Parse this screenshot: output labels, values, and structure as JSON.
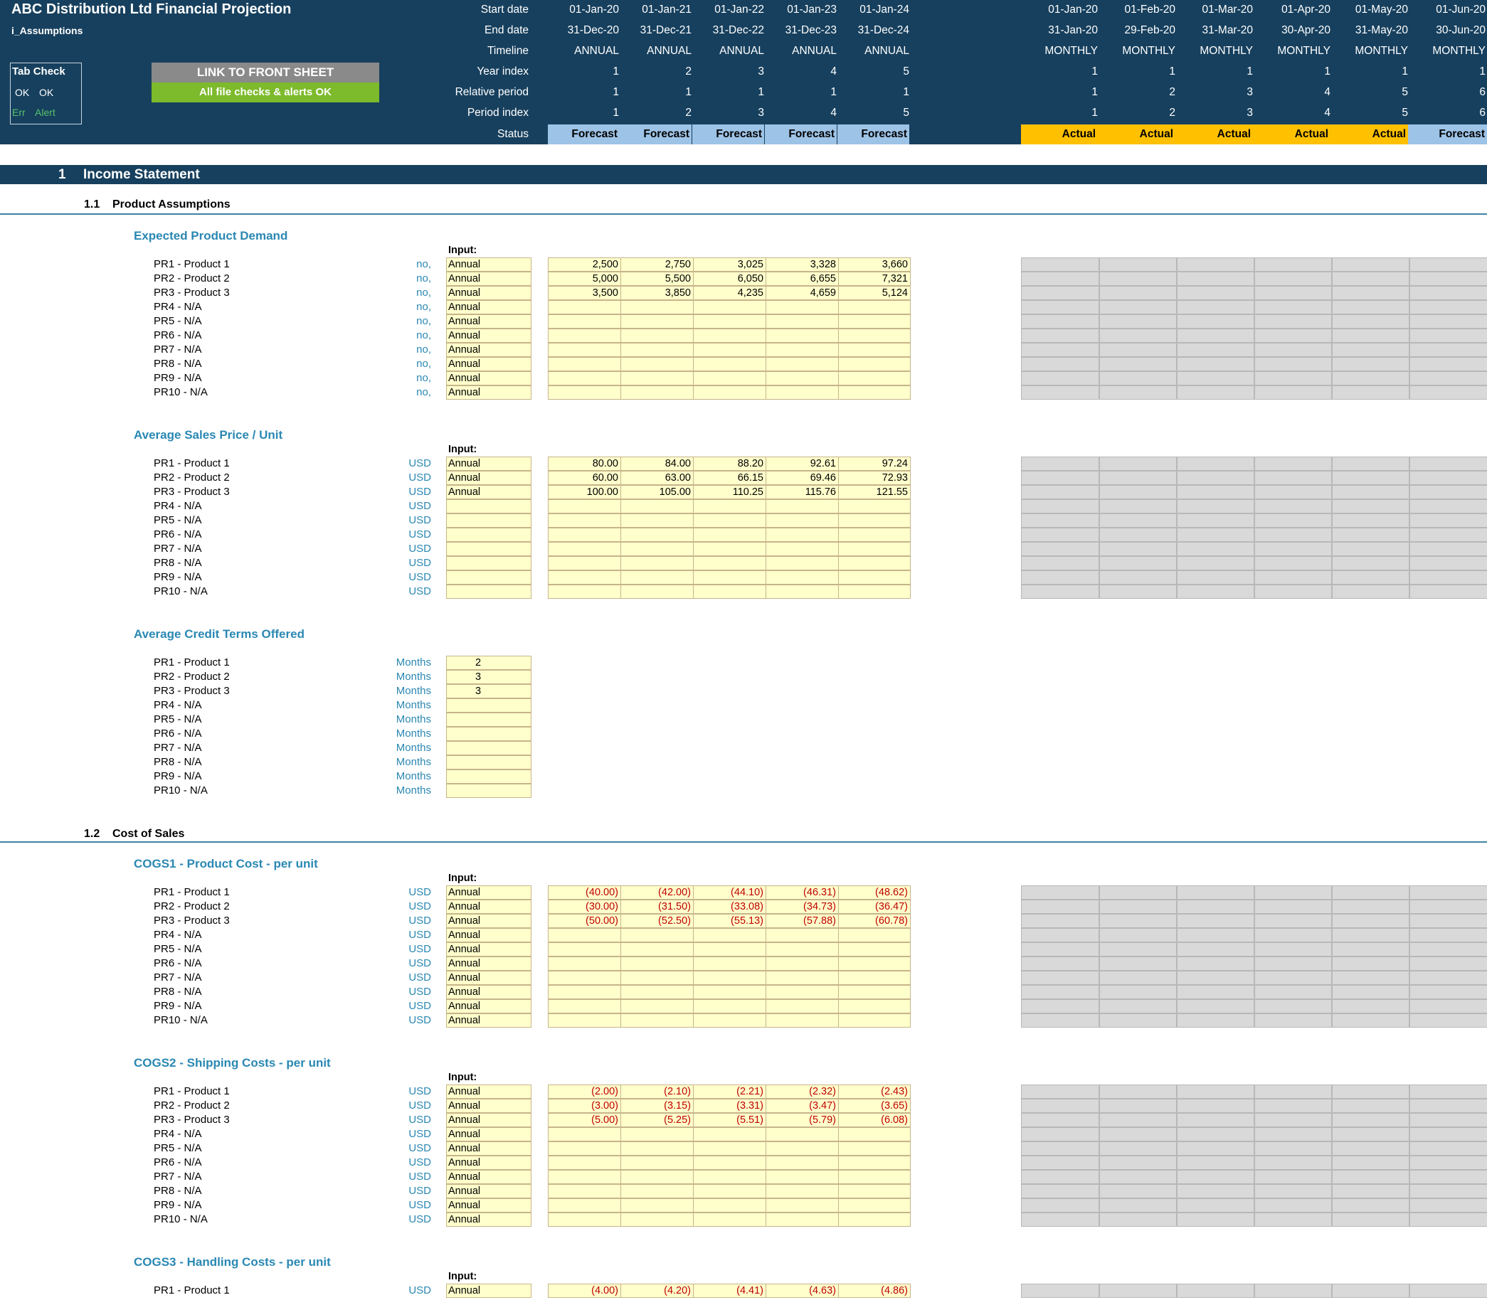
{
  "header": {
    "title": "ABC Distribution Ltd Financial Projection",
    "sheet_name": "i_Assumptions",
    "tab_check": {
      "title": "Tab Check",
      "ok1": "OK",
      "ok2": "OK",
      "err": "Err",
      "alert": "Alert"
    },
    "link_button": "LINK TO FRONT SHEET",
    "checks_status": "All file checks & alerts OK",
    "row_labels": {
      "start_date": "Start date",
      "end_date": "End date",
      "timeline": "Timeline",
      "year_index": "Year index",
      "relative_period": "Relative period",
      "period_index": "Period index",
      "status": "Status"
    },
    "annual": {
      "start": [
        "01-Jan-20",
        "01-Jan-21",
        "01-Jan-22",
        "01-Jan-23",
        "01-Jan-24"
      ],
      "end": [
        "31-Dec-20",
        "31-Dec-21",
        "31-Dec-22",
        "31-Dec-23",
        "31-Dec-24"
      ],
      "timeline": [
        "ANNUAL",
        "ANNUAL",
        "ANNUAL",
        "ANNUAL",
        "ANNUAL"
      ],
      "year_index": [
        "1",
        "2",
        "3",
        "4",
        "5"
      ],
      "relative": [
        "1",
        "1",
        "1",
        "1",
        "1"
      ],
      "period_index": [
        "1",
        "2",
        "3",
        "4",
        "5"
      ],
      "status": [
        "Forecast",
        "Forecast",
        "Forecast",
        "Forecast",
        "Forecast"
      ]
    },
    "monthly": {
      "start": [
        "01-Jan-20",
        "01-Feb-20",
        "01-Mar-20",
        "01-Apr-20",
        "01-May-20",
        "01-Jun-20"
      ],
      "end": [
        "31-Jan-20",
        "29-Feb-20",
        "31-Mar-20",
        "30-Apr-20",
        "31-May-20",
        "30-Jun-20"
      ],
      "timeline": [
        "MONTHLY",
        "MONTHLY",
        "MONTHLY",
        "MONTHLY",
        "MONTHLY",
        "MONTHLY"
      ],
      "year_index": [
        "1",
        "1",
        "1",
        "1",
        "1",
        "1"
      ],
      "relative": [
        "1",
        "2",
        "3",
        "4",
        "5",
        "6"
      ],
      "period_index": [
        "1",
        "2",
        "3",
        "4",
        "5",
        "6"
      ],
      "status": [
        "Actual",
        "Actual",
        "Actual",
        "Actual",
        "Actual",
        "Forecast"
      ]
    }
  },
  "section": {
    "number": "1",
    "title": "Income Statement"
  },
  "subsections": [
    {
      "number": "1.1",
      "title": "Product Assumptions"
    },
    {
      "number": "1.2",
      "title": "Cost of Sales"
    }
  ],
  "products": [
    "PR1 - Product 1",
    "PR2 - Product 2",
    "PR3 - Product 3",
    "PR4 - N/A",
    "PR5 - N/A",
    "PR6 - N/A",
    "PR7 - N/A",
    "PR8 - N/A",
    "PR9 - N/A",
    "PR10 - N/A"
  ],
  "input_label": "Input:",
  "blocks": [
    {
      "title": "Expected Product Demand",
      "unit": "no,",
      "input_text": "Annual",
      "show_input_label": true,
      "values": [
        [
          "2,500",
          "2,750",
          "3,025",
          "3,328",
          "3,660"
        ],
        [
          "5,000",
          "5,500",
          "6,050",
          "6,655",
          "7,321"
        ],
        [
          "3,500",
          "3,850",
          "4,235",
          "4,659",
          "5,124"
        ]
      ]
    },
    {
      "title": "Average Sales Price / Unit",
      "unit": "USD",
      "input_text": [
        "Annual",
        "Annual",
        "Annual",
        "",
        "",
        "",
        "",
        "",
        "",
        ""
      ],
      "show_input_label": true,
      "values": [
        [
          "80.00",
          "84.00",
          "88.20",
          "92.61",
          "97.24"
        ],
        [
          "60.00",
          "63.00",
          "66.15",
          "69.46",
          "72.93"
        ],
        [
          "100.00",
          "105.00",
          "110.25",
          "115.76",
          "121.55"
        ]
      ]
    },
    {
      "title": "Average Credit Terms Offered",
      "unit": "Months",
      "input_values": [
        "2",
        "3",
        "3",
        "",
        "",
        "",
        "",
        "",
        "",
        ""
      ],
      "show_input_label": false,
      "values": []
    },
    {
      "title": "COGS1 - Product Cost - per unit",
      "unit": "USD",
      "input_text": "Annual",
      "show_input_label": true,
      "values": [
        [
          "(40.00)",
          "(42.00)",
          "(44.10)",
          "(46.31)",
          "(48.62)"
        ],
        [
          "(30.00)",
          "(31.50)",
          "(33.08)",
          "(34.73)",
          "(36.47)"
        ],
        [
          "(50.00)",
          "(52.50)",
          "(55.13)",
          "(57.88)",
          "(60.78)"
        ]
      ]
    },
    {
      "title": "COGS2 - Shipping Costs - per unit",
      "unit": "USD",
      "input_text": "Annual",
      "show_input_label": true,
      "values": [
        [
          "(2.00)",
          "(2.10)",
          "(2.21)",
          "(2.32)",
          "(2.43)"
        ],
        [
          "(3.00)",
          "(3.15)",
          "(3.31)",
          "(3.47)",
          "(3.65)"
        ],
        [
          "(5.00)",
          "(5.25)",
          "(5.51)",
          "(5.79)",
          "(6.08)"
        ]
      ]
    },
    {
      "title": "COGS3 - Handling Costs - per unit",
      "unit": "USD",
      "input_text": "Annual",
      "show_input_label": true,
      "values": [
        [
          "(4.00)",
          "(4.20)",
          "(4.41)",
          "(4.63)",
          "(4.86)"
        ]
      ]
    }
  ],
  "colors": {
    "header_bg": "#17405e",
    "input_fill": "#ffffcc",
    "forecast": "#9dc3e6",
    "actual": "#ffc000",
    "accent_text": "#2a88b3",
    "negative": "#c00000"
  }
}
